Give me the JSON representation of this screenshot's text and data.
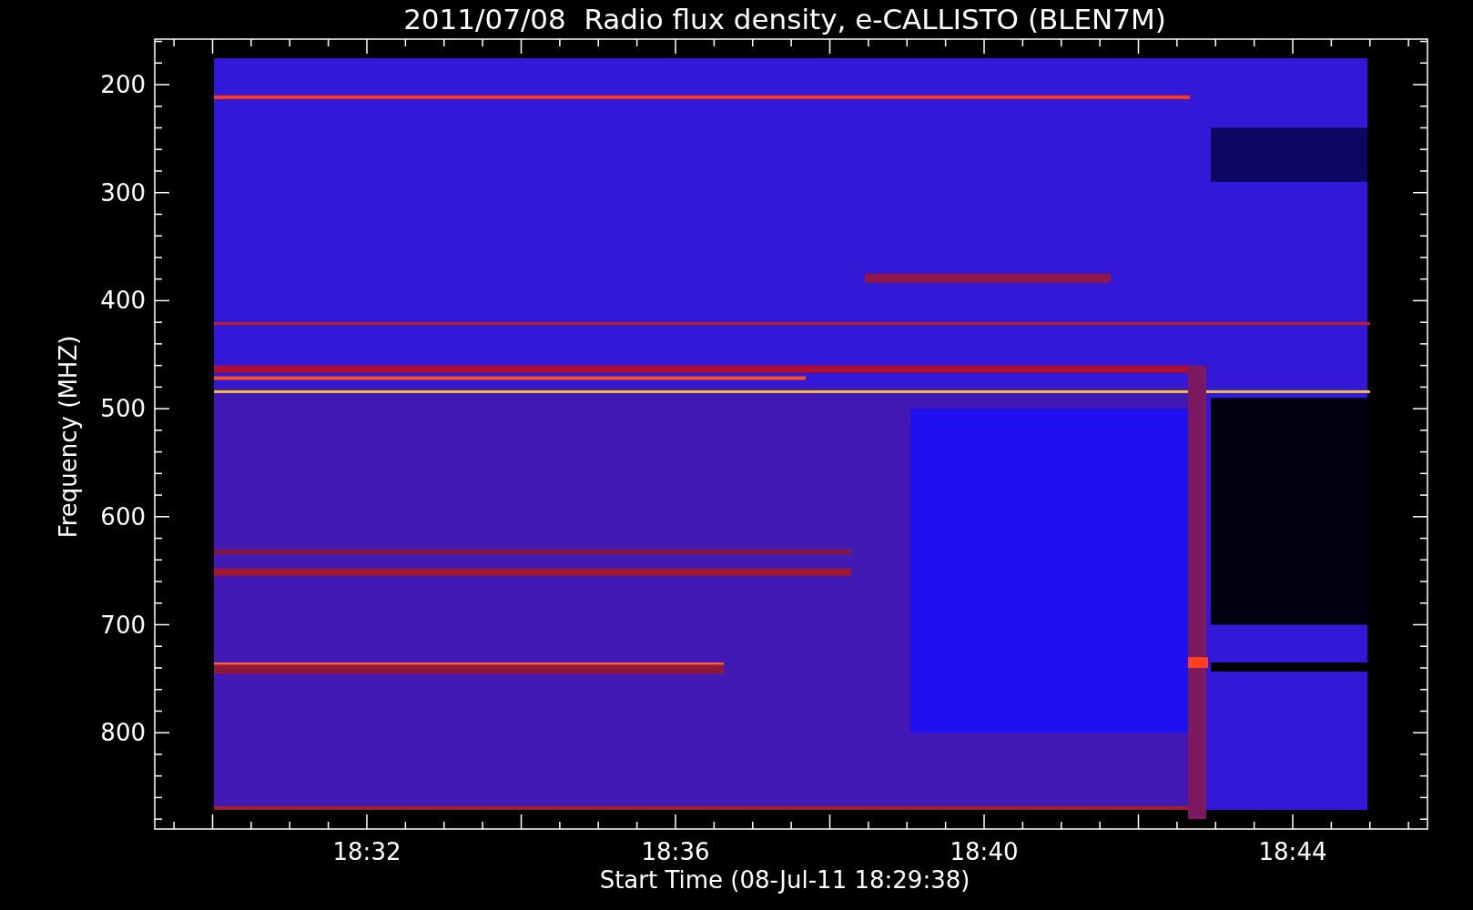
{
  "chart": {
    "title": "2011/07/08  Radio flux density, e-CALLISTO (BLEN7M)",
    "ylabel": "Frequency (MHZ)",
    "xlabel": "Start Time (08-Jul-11 18:29:38)",
    "y_tick_labels": [
      "200",
      "300",
      "400",
      "500",
      "600",
      "700",
      "800"
    ],
    "x_tick_labels": [
      "18:32",
      "18:36",
      "18:40",
      "18:44"
    ]
  }
}
